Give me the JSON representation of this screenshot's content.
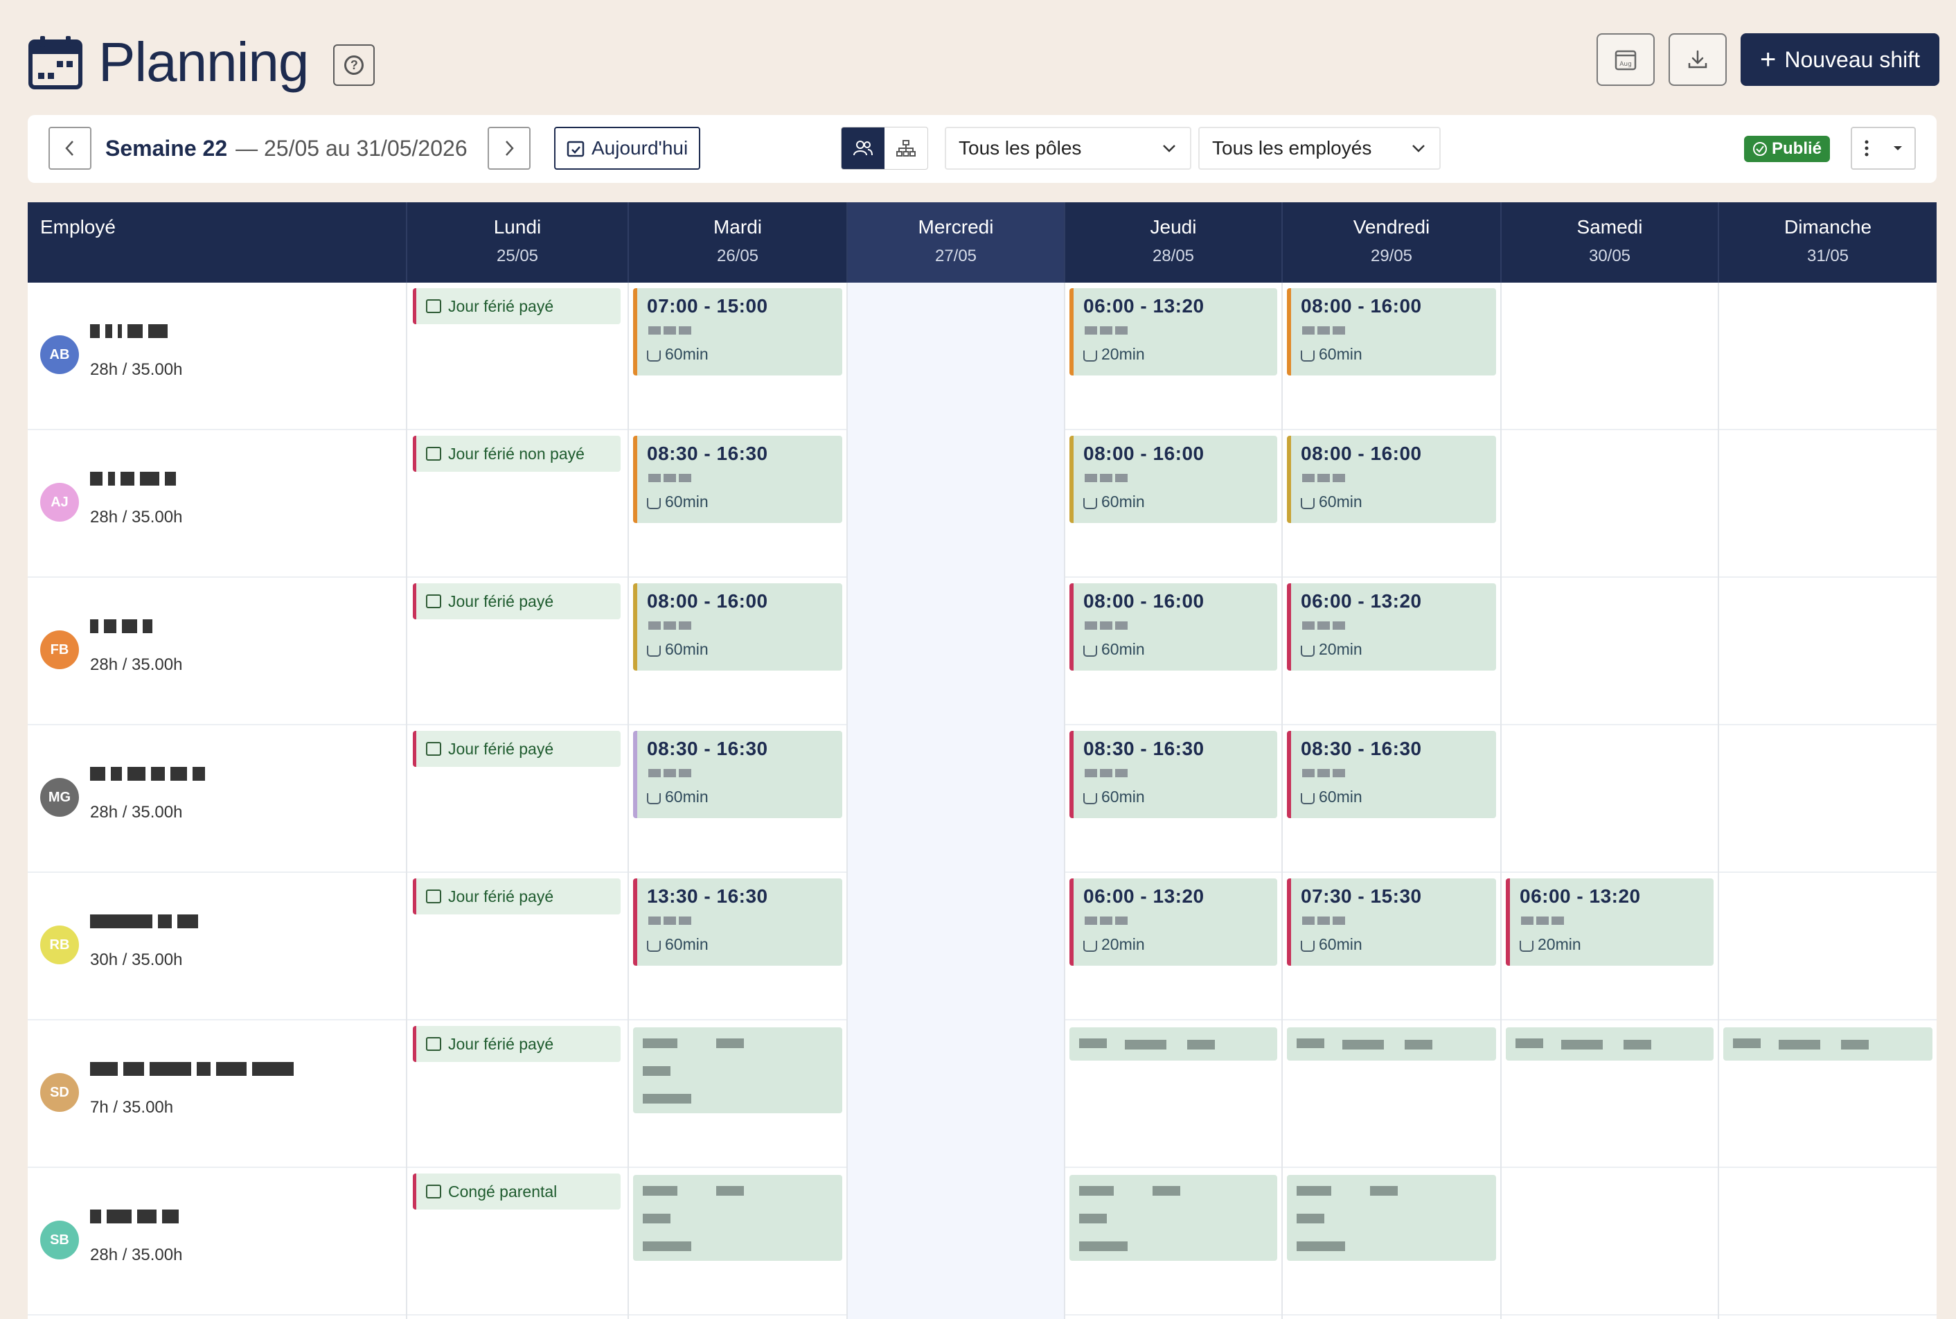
{
  "header": {
    "title": "Planning",
    "help_icon": "question-circle-icon",
    "buttons": {
      "calendar_aug_icon": "calendar-aug-icon",
      "download_icon": "download-icon",
      "new_shift": "Nouveau shift"
    }
  },
  "toolbar": {
    "week": "Semaine 22",
    "range": "— 25/05 au 31/05/2026",
    "today": "Aujourd'hui",
    "view_modes": [
      "users-view",
      "org-view"
    ],
    "poles_select": "Tous les pôles",
    "employees_select": "Tous les employés",
    "status": "Publié"
  },
  "grid": {
    "employee_header": "Employé",
    "days": [
      {
        "name": "Lundi",
        "date": "25/05"
      },
      {
        "name": "Mardi",
        "date": "26/05"
      },
      {
        "name": "Mercredi",
        "date": "27/05"
      },
      {
        "name": "Jeudi",
        "date": "28/05"
      },
      {
        "name": "Vendredi",
        "date": "29/05"
      },
      {
        "name": "Samedi",
        "date": "30/05"
      },
      {
        "name": "Dimanche",
        "date": "31/05"
      }
    ],
    "rows": [
      {
        "initials": "AB",
        "hours": "28h / 35.00h",
        "absence": "Jour férié payé",
        "shifts": [
          {
            "time": "07:00 - 15:00",
            "pause": "60min"
          },
          {
            "time": "08:00 - 16:00",
            "pause": "60min"
          },
          {
            "time": "06:00 - 13:20",
            "pause": "20min"
          },
          {
            "time": "08:00 - 16:00",
            "pause": "60min"
          }
        ]
      },
      {
        "initials": "AJ",
        "hours": "28h / 35.00h",
        "absence": "Jour férié non payé",
        "shifts": [
          {
            "time": "08:30 - 16:30",
            "pause": "60min"
          },
          {
            "time": "08:00 - 16:00",
            "pause": "60min"
          },
          {
            "time": "08:00 - 16:00",
            "pause": "60min"
          },
          {
            "time": "08:00 - 16:00",
            "pause": "60min"
          }
        ]
      },
      {
        "initials": "FB",
        "hours": "28h / 35.00h",
        "absence": "Jour férié payé",
        "shifts": [
          {
            "time": "08:00 - 16:00",
            "pause": "60min"
          },
          {
            "time": "06:00 - 13:20",
            "pause": "20min"
          },
          {
            "time": "08:00 - 16:00",
            "pause": "60min"
          },
          {
            "time": "06:00 - 13:20",
            "pause": "20min"
          }
        ]
      },
      {
        "initials": "MG",
        "hours": "28h / 35.00h",
        "absence": "Jour férié payé",
        "shifts": [
          {
            "time": "08:30 - 16:30",
            "pause": "60min"
          },
          {
            "time": "08:30 - 16:30",
            "pause": "60min"
          },
          {
            "time": "08:30 - 16:30",
            "pause": "60min"
          },
          {
            "time": "08:30 - 16:30",
            "pause": "60min"
          }
        ]
      },
      {
        "initials": "RB",
        "hours": "30h / 35.00h",
        "absence": "Jour férié payé",
        "shifts": [
          {
            "time": "13:30 - 16:30",
            "pause": "60min"
          },
          {
            "time": "06:00 - 13:20",
            "pause": "20min"
          },
          {
            "time": "06:00 - 13:20",
            "pause": "20min"
          },
          {
            "time": "07:30 - 15:30",
            "pause": "60min"
          },
          {
            "time": "06:00 - 13:20",
            "pause": "20min"
          }
        ]
      },
      {
        "initials": "SD",
        "hours": "7h / 35.00h",
        "absence": "Jour férié payé",
        "shifts": []
      },
      {
        "initials": "SB",
        "hours": "28h / 35.00h",
        "absence": "Congé parental",
        "shifts": []
      }
    ]
  },
  "colors": {
    "navy": "#1d2b4f",
    "shift_bg": "#d7e8dd",
    "published": "#2f8a3b",
    "orange": "#e28a2b",
    "red": "#c8325a",
    "olive": "#c9a437",
    "lavender": "#b8a4d6",
    "avatars": [
      "#5576c9",
      "#e9a5e0",
      "#e9873b",
      "#6b6b6b",
      "#e6df5a",
      "#d7a86a",
      "#62c6ae"
    ]
  }
}
